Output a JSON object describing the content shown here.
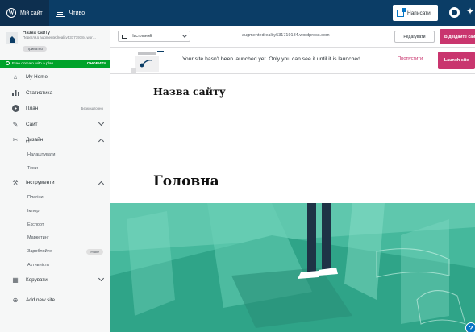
{
  "masterbar": {
    "my_site_label": "Мій сайт",
    "reader_label": "Чтиво",
    "write_label": "Написати",
    "icons": {
      "my_site": "wordpress-logo-icon",
      "reader": "reader-icon",
      "write": "write-icon",
      "profile": "avatar",
      "notifications": "bell-icon"
    }
  },
  "sidebar": {
    "site": {
      "name": "Назва сайту",
      "url": "Перегляд augmentedreality531719184.wordpress.com",
      "badge": "Приватно"
    },
    "plan_banner": {
      "text": "Free domain with a plan",
      "action": "ОНОВИТИ"
    },
    "items": [
      {
        "label": "My Home",
        "icon": "home-icon"
      },
      {
        "label": "Статистика",
        "icon": "stats-icon"
      },
      {
        "label": "План",
        "icon": "plan-icon",
        "extra": "Безкоштовно"
      },
      {
        "label": "Сайт",
        "icon": "pencil-icon"
      },
      {
        "label": "Дизайн",
        "icon": "design-icon"
      },
      {
        "label": "Інструменти",
        "icon": "tools-icon"
      },
      {
        "label": "Керувати",
        "icon": "manage-icon"
      },
      {
        "label": "Add new site",
        "icon": "add-circle-icon"
      }
    ],
    "design_sub": [
      "Налаштувати",
      "Теми"
    ],
    "tools_sub": [
      "Плагіни",
      "Імпорт",
      "Експорт",
      "Маркетинг",
      "Заробляйте",
      "Активність"
    ],
    "new_badge": "Нове"
  },
  "preview_bar": {
    "device": "Настільний",
    "url": "augmentedreality531719184.wordpress.com",
    "edit_label": "Редагувати",
    "visit_label": "Відвідайте сайт"
  },
  "notice": {
    "text": "Your site hasn't been launched yet. Only you can see it until it is launched.",
    "skip_label": "Пропустити",
    "launch_label": "Launch site"
  },
  "site_preview": {
    "site_title": "Назва сайту",
    "page_heading": "Головна"
  },
  "help_label": "?"
}
